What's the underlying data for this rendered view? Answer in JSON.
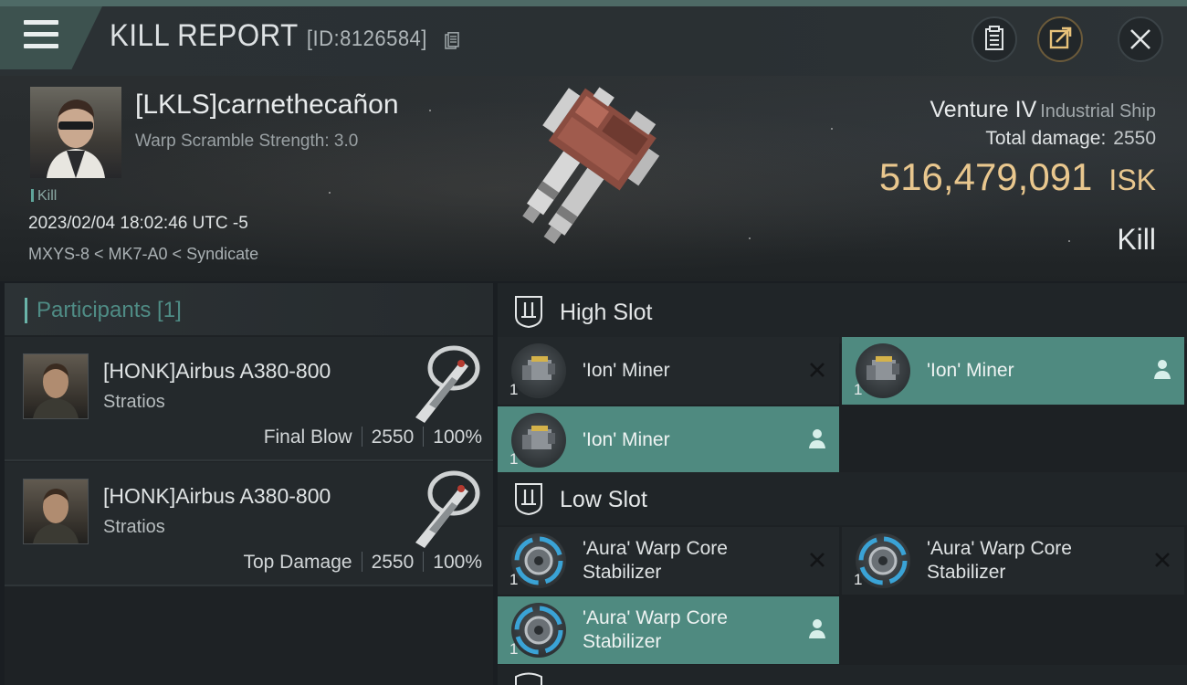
{
  "header": {
    "title": "KILL REPORT",
    "report_id": "[ID:8126584]"
  },
  "victim": {
    "name": "[LKLS]carnethecañon",
    "warp_scramble": "Warp Scramble Strength: 3.0",
    "kill_tag": "Kill",
    "datetime": "2023/02/04 18:02:46 UTC -5",
    "location": "MXYS-8 < MK7-A0 < Syndicate",
    "ship_name": "Venture IV",
    "ship_class": "Industrial Ship",
    "total_damage_label": "Total damage:",
    "total_damage": "2550",
    "isk_value": "516,479,091",
    "isk_unit": "ISK",
    "result": "Kill"
  },
  "participants": {
    "title": "Participants [1]",
    "rows": [
      {
        "name": "[HONK]Airbus A380-800",
        "ship": "Stratios",
        "role": "Final Blow",
        "damage": "2550",
        "percent": "100%"
      },
      {
        "name": "[HONK]Airbus A380-800",
        "ship": "Stratios",
        "role": "Top Damage",
        "damage": "2550",
        "percent": "100%"
      }
    ]
  },
  "slots": {
    "high": {
      "title": "High Slot",
      "modules": [
        {
          "name": "'Ion' Miner",
          "qty": "1",
          "state": "destroyed"
        },
        {
          "name": "'Ion' Miner",
          "qty": "1",
          "state": "dropped"
        },
        {
          "name": "'Ion' Miner",
          "qty": "1",
          "state": "dropped"
        }
      ]
    },
    "low": {
      "title": "Low Slot",
      "modules": [
        {
          "name": "'Aura' Warp Core Stabilizer",
          "qty": "1",
          "state": "destroyed"
        },
        {
          "name": "'Aura' Warp Core Stabilizer",
          "qty": "1",
          "state": "destroyed"
        },
        {
          "name": "'Aura' Warp Core Stabilizer",
          "qty": "1",
          "state": "dropped"
        }
      ]
    }
  },
  "colors": {
    "accent": "#4f8a80",
    "isk": "#e9c78e",
    "participants_title": "#4f8c85"
  },
  "icons": {
    "menu": "hamburger-menu-icon",
    "copy": "copy-icon",
    "report": "clipboard-icon",
    "share": "share-icon",
    "close": "close-icon",
    "slot": "slot-icon",
    "destroyed": "x-icon",
    "dropped": "person-icon"
  }
}
